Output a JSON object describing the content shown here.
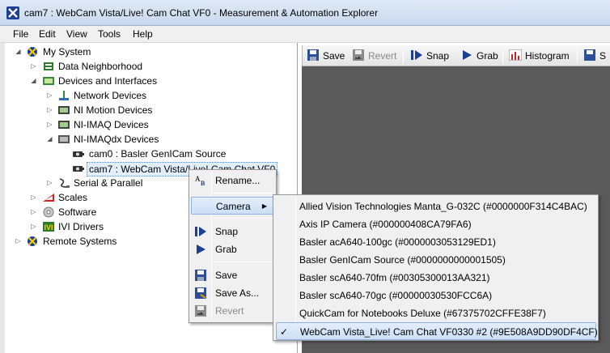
{
  "window": {
    "title": "cam7 : WebCam Vista/Live! Cam Chat VF0  - Measurement & Automation Explorer"
  },
  "menubar": [
    "File",
    "Edit",
    "View",
    "Tools",
    "Help"
  ],
  "tree": [
    {
      "label": "My System",
      "icon": "my-system-icon",
      "expanded": true
    },
    {
      "label": "Data Neighborhood",
      "icon": "data-neighborhood-icon"
    },
    {
      "label": "Devices and Interfaces",
      "icon": "devices-icon",
      "expanded": true
    },
    {
      "label": "Network Devices",
      "icon": "network-icon"
    },
    {
      "label": "NI Motion Devices",
      "icon": "motion-icon"
    },
    {
      "label": "NI-IMAQ Devices",
      "icon": "imaq-icon"
    },
    {
      "label": "NI-IMAQdx Devices",
      "icon": "imaqdx-icon",
      "expanded": true
    },
    {
      "label": "cam0 : Basler GenICam Source",
      "icon": "camera-icon"
    },
    {
      "label": "cam7 : WebCam Vista/Live! Cam Chat VF0",
      "icon": "camera-icon",
      "selected": true
    },
    {
      "label": "Serial & Parallel",
      "icon": "serial-icon"
    },
    {
      "label": "Scales",
      "icon": "scales-icon"
    },
    {
      "label": "Software",
      "icon": "software-icon"
    },
    {
      "label": "IVI Drivers",
      "icon": "ivi-icon"
    },
    {
      "label": "Remote Systems",
      "icon": "remote-icon"
    }
  ],
  "toolbar": {
    "save": "Save",
    "revert": "Revert",
    "snap": "Snap",
    "grab": "Grab",
    "histogram": "Histogram",
    "more": "S"
  },
  "context_menu": {
    "rename": "Rename...",
    "camera": "Camera",
    "snap": "Snap",
    "grab": "Grab",
    "save": "Save",
    "save_as": "Save As...",
    "revert": "Revert"
  },
  "camera_submenu": [
    "Allied Vision Technologies Manta_G-032C (#0000000F314C4BAC)",
    "Axis IP Camera (#000000408CA79FA6)",
    "Basler acA640-100gc (#0000003053129ED1)",
    "Basler GenICam Source  (#0000000000001505)",
    "Basler scA640-70fm (#00305300013AA321)",
    "Basler scA640-70gc (#00000030530FCC6A)",
    "QuickCam for Notebooks Deluxe  (#67375702CFFE38F7)",
    "WebCam Vista_Live! Cam Chat VF0330 #2  (#9E508A9DD90DF4CF)"
  ],
  "camera_submenu_checked_index": 7,
  "checkmark": "✓"
}
